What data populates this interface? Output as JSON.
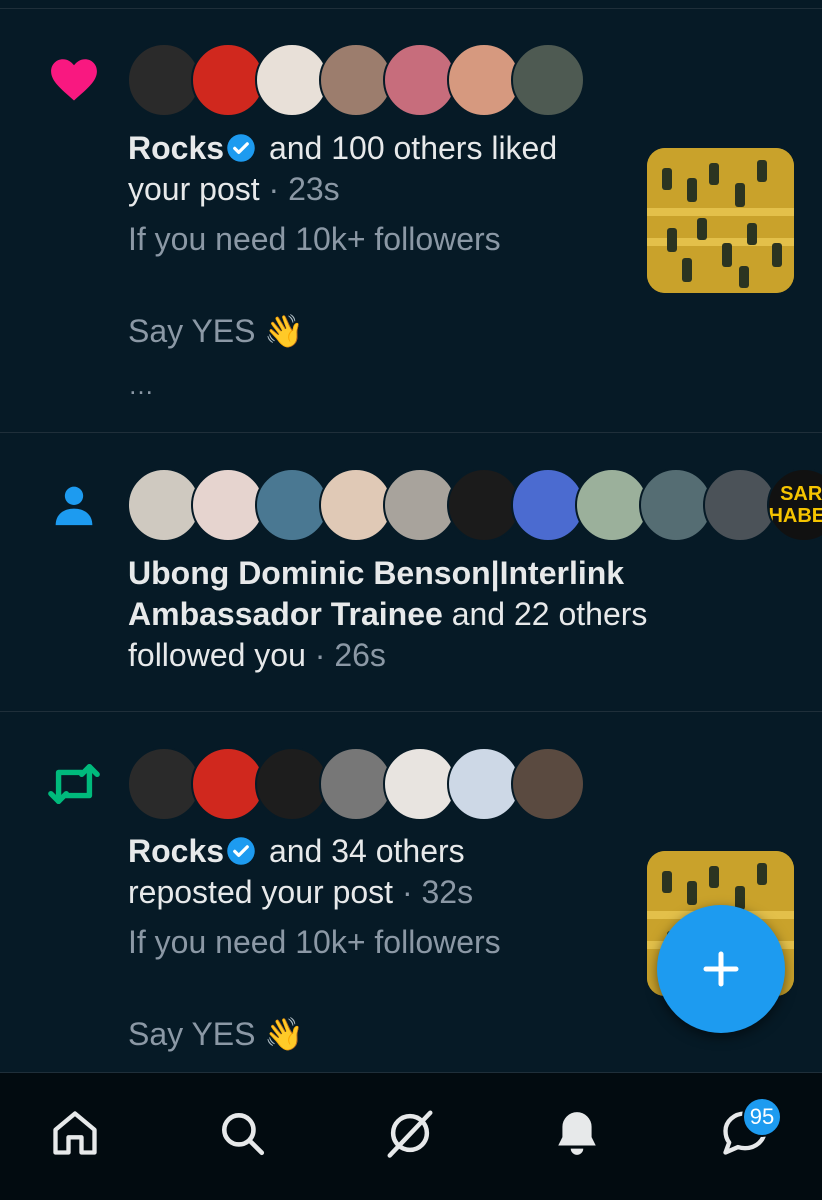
{
  "notifications": [
    {
      "type": "like",
      "type_icon": "heart-icon",
      "actor": "Rocks",
      "rest_line1": " and 100 others liked",
      "line2": "your post",
      "time": " · 23s",
      "snippet_line1": "If you need 10k+ followers",
      "snippet_line2": "Say YES 👋",
      "ellipsis": "…",
      "avatar_colors": [
        "#2a2a2a",
        "#d0281e",
        "#e8e0d8",
        "#9c7d6d",
        "#c76d7c",
        "#d6997f",
        "#4e5a52"
      ]
    },
    {
      "type": "follow",
      "type_icon": "person-icon",
      "actor_line1": "Ubong Dominic Benson|Interlink",
      "actor_line2": "Ambassador Trainee",
      "rest_line2": " and 22 others",
      "line3": "followed you",
      "time": " · 26s",
      "avatar_colors": [
        "#cfc9c0",
        "#e6d4cf",
        "#4a7892",
        "#e0c9b6",
        "#a8a39c",
        "#1b1b1b",
        "#4b6bd0",
        "#9bb09b",
        "#556d73",
        "#4b5258",
        "#111111"
      ],
      "last_avatar_text_1": "SARI",
      "last_avatar_text_2": "HABER"
    },
    {
      "type": "repost",
      "type_icon": "repost-icon",
      "actor": "Rocks",
      "rest_line1": " and 34 others",
      "line2": "reposted your post",
      "time": " · 32s",
      "snippet_line1": "If you need 10k+ followers",
      "snippet_line2": "Say YES 👋",
      "avatar_colors": [
        "#2a2a2a",
        "#d0281e",
        "#1d1d1d",
        "#777777",
        "#e8e4e0",
        "#cdd8e6",
        "#5a4a40"
      ]
    }
  ],
  "fab": {
    "icon": "compose-plus-icon",
    "label": "+"
  },
  "tabbar": {
    "items": [
      "home-icon",
      "search-icon",
      "grok-icon",
      "notifications-bell-icon",
      "messages-icon"
    ],
    "messages_badge": "95"
  },
  "colors": {
    "background": "#061a26",
    "accent": "#1d9bf0",
    "like": "#f91880",
    "repost": "#00ba7c",
    "muted_text": "#8b98a5"
  }
}
